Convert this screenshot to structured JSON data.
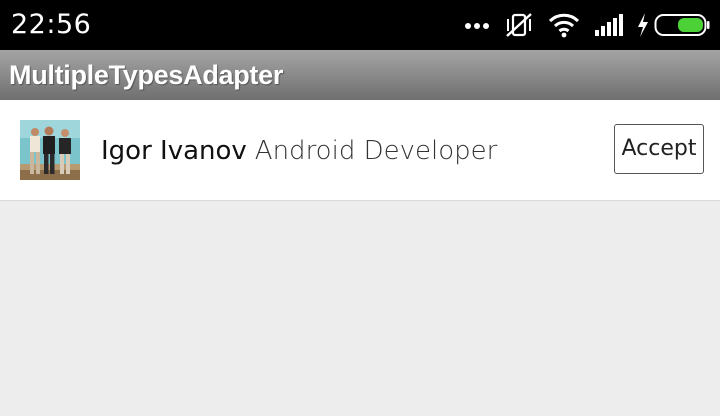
{
  "status_bar": {
    "time": "22:56",
    "icons": [
      "more-dots-icon",
      "vibrate-off-icon",
      "wifi-icon",
      "signal-icon",
      "charging-bolt-icon",
      "battery-icon"
    ]
  },
  "action_bar": {
    "title": "MultipleTypesAdapter"
  },
  "list": {
    "items": [
      {
        "name": "Igor Ivanov",
        "job": "Android Developer",
        "button_label": "Accept",
        "avatar": "photo-icon"
      }
    ]
  },
  "colors": {
    "status_bar_bg": "#000000",
    "action_bar_bg": "#8a8a8a",
    "list_bg": "#ffffff",
    "page_bg": "#ededed",
    "battery_fill": "#4cd137"
  }
}
